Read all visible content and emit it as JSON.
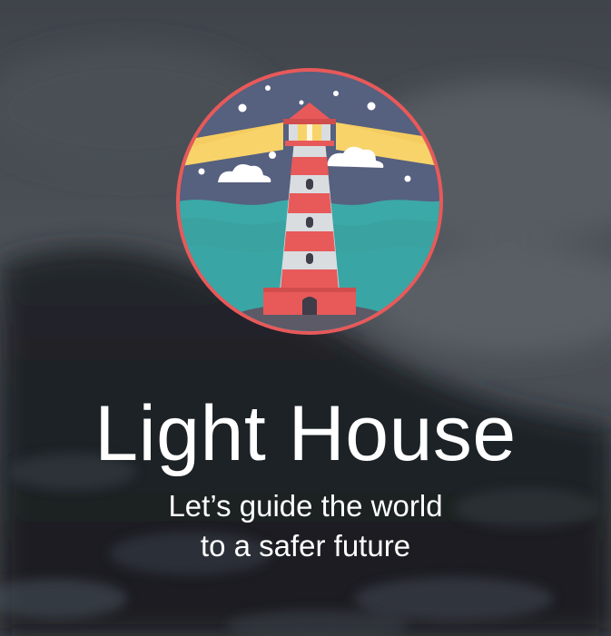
{
  "app": {
    "title": "Light House",
    "tagline_line1": "Let’s guide the world",
    "tagline_line2": "to a safer future"
  },
  "logo": {
    "icon": "lighthouse-icon"
  },
  "colors": {
    "sky": "#56607f",
    "sea": "#3ba9a8",
    "ring": "#e8595a",
    "tower_red": "#e8595a",
    "tower_white": "#d9dde0",
    "light_beam": "#f7d36a",
    "text": "#ffffff"
  }
}
